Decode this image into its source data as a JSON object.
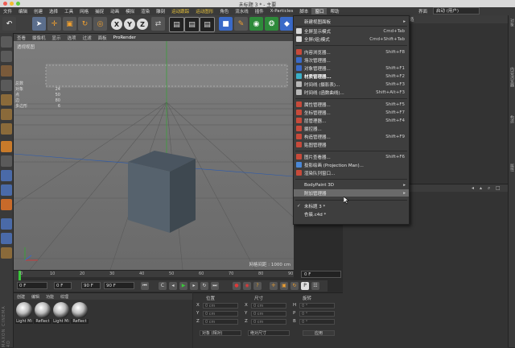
{
  "window": {
    "title": "未标题 3 * - 主要",
    "lights": [
      "#ee5d54",
      "#f4bc2f",
      "#5fcb3f"
    ]
  },
  "menubar": {
    "items": [
      "文件",
      "编辑",
      "创建",
      "选择",
      "工具",
      "网格",
      "捕捉",
      "动画",
      "模拟",
      "渲染",
      "雕刻",
      "运动跟踪",
      "运动图形",
      "角色",
      "流水线",
      "插件",
      "X-Particles",
      "脚本",
      "窗口",
      "帮助"
    ]
  },
  "viewport": {
    "menu": [
      "查看",
      "摄像机",
      "显示",
      "选项",
      "过滤",
      "面板",
      "ProRender"
    ],
    "label": "透视视图",
    "hud": [
      {
        "k": "总数",
        "v": ""
      },
      {
        "k": "对象",
        "v": "24"
      },
      {
        "k": "点",
        "v": "50"
      },
      {
        "k": "边",
        "v": "80"
      },
      {
        "k": "多边形",
        "v": "6"
      }
    ],
    "grid_label": "网格间距 : 1000 cm"
  },
  "timeline": {
    "ticks": [
      "0",
      "10",
      "20",
      "30",
      "40",
      "50",
      "60",
      "70",
      "80",
      "90"
    ],
    "frame_right": "0 F"
  },
  "playback": {
    "start": "0 F",
    "current": "0 F",
    "end": "90 F",
    "end2": "90 F"
  },
  "materials": {
    "tabs": [
      "创建",
      "编辑",
      "功能",
      "纹理"
    ],
    "items": [
      "Light Mi",
      "Reflect",
      "Light Mi",
      "Reflect"
    ],
    "side_label": "MAXON CINEMA 4D"
  },
  "coordinates": {
    "header": [
      "位置",
      "尺寸",
      "旋转"
    ],
    "rows": [
      {
        "axis": "X",
        "pos": "0 cm",
        "size": "0 cm",
        "rot_label": "H",
        "rot": "0 °"
      },
      {
        "axis": "Y",
        "pos": "0 cm",
        "size": "0 cm",
        "rot_label": "P",
        "rot": "0 °"
      },
      {
        "axis": "Z",
        "pos": "0 cm",
        "size": "0 cm",
        "rot_label": "B",
        "rot": "0 °"
      }
    ],
    "mode": "对象 (相对)",
    "size_mode": "绝对尺寸",
    "apply": "应用"
  },
  "object_panel": {
    "tabs": [
      "对象",
      "场次",
      "内容浏览器",
      "构造"
    ],
    "layout_label": "界面",
    "layout_value": "启动 (用户)"
  },
  "right_tabs": [
    "对象",
    "内容浏览器",
    "构造",
    "属性"
  ],
  "dropdown": {
    "items": [
      {
        "label": "新建视图面板",
        "shortcut": "",
        "arrow": true,
        "icon": ""
      },
      {
        "label": "全屏显示模式",
        "shortcut": "Cmd+Tab",
        "arrow": false,
        "icon": "#d8d8d8"
      },
      {
        "label": "全屏(组)模式",
        "shortcut": "Cmd+Shift+Tab",
        "arrow": false,
        "icon": "#d8d8d8"
      },
      {
        "label": "内容浏览器...",
        "shortcut": "Shift+F8",
        "arrow": false,
        "icon": "#c84a3a"
      },
      {
        "label": "场次管理器...",
        "shortcut": "",
        "arrow": false,
        "icon": "#3a6ac8"
      },
      {
        "label": "对象管理器...",
        "shortcut": "Shift+F1",
        "arrow": false,
        "icon": "#3a6ac8"
      },
      {
        "label": "材质管理器...",
        "shortcut": "Shift+F2",
        "arrow": false,
        "icon": "#3ab0c8"
      },
      {
        "label": "时间线 (摄影表)...",
        "shortcut": "Shift+F3",
        "arrow": false,
        "icon": "#b8b8b8"
      },
      {
        "label": "时间线 (函数曲线)...",
        "shortcut": "Shift+Alt+F3",
        "arrow": false,
        "icon": "#b8b8b8"
      },
      {
        "label": "属性管理器...",
        "shortcut": "Shift+F5",
        "arrow": false,
        "icon": "#c84a3a"
      },
      {
        "label": "坐标管理器...",
        "shortcut": "Shift+F7",
        "arrow": false,
        "icon": "#c84a3a"
      },
      {
        "label": "层管理器...",
        "shortcut": "Shift+F4",
        "arrow": false,
        "icon": "#c84a3a"
      },
      {
        "label": "摄控器...",
        "shortcut": "",
        "arrow": false,
        "icon": "#c84a3a"
      },
      {
        "label": "构造管理器...",
        "shortcut": "Shift+F9",
        "arrow": false,
        "icon": "#c84a3a"
      },
      {
        "label": "贴图管理器",
        "shortcut": "",
        "arrow": false,
        "icon": "#c84a3a"
      },
      {
        "label": "图片查看器...",
        "shortcut": "Shift+F6",
        "arrow": false,
        "icon": "#c84a3a"
      },
      {
        "label": "投影绘画 (Projection Man)...",
        "shortcut": "",
        "arrow": false,
        "icon": "#4a88d8"
      },
      {
        "label": "渲染队列窗口...",
        "shortcut": "",
        "arrow": false,
        "icon": "#c84a3a"
      },
      {
        "label": "BodyPaint 3D",
        "shortcut": "",
        "arrow": true,
        "icon": ""
      },
      {
        "label": "附加管理器",
        "shortcut": "",
        "arrow": true,
        "icon": ""
      },
      {
        "label": "未标题 3 *",
        "shortcut": "",
        "arrow": false,
        "icon": "",
        "check": true
      },
      {
        "label": "杏晨.c4d *",
        "shortcut": "",
        "arrow": false,
        "icon": ""
      }
    ]
  }
}
